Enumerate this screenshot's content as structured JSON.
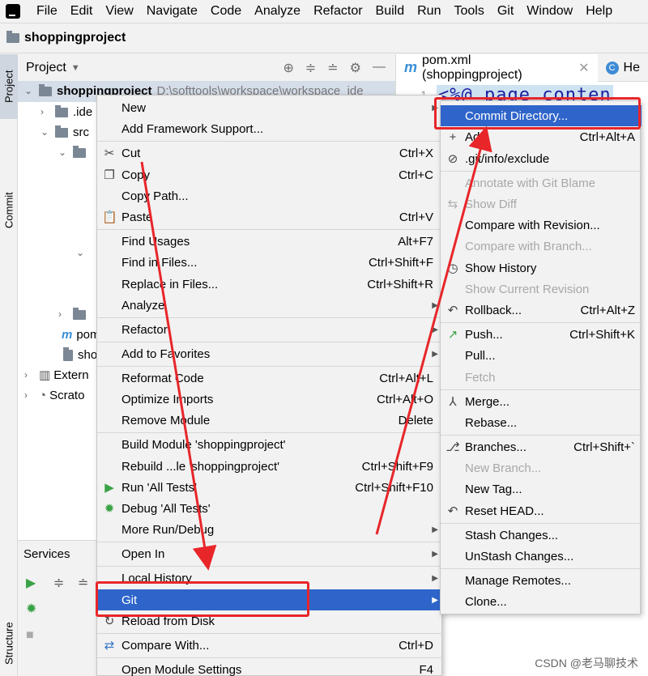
{
  "menubar": {
    "items": [
      "File",
      "Edit",
      "View",
      "Navigate",
      "Code",
      "Analyze",
      "Refactor",
      "Build",
      "Run",
      "Tools",
      "Git",
      "Window",
      "Help"
    ]
  },
  "breadcrumb": {
    "project": "shoppingproject"
  },
  "stripe": {
    "project_tab": "Project",
    "commit_tab": "Commit",
    "structure_tab": "Structure"
  },
  "project_panel": {
    "title": "Project",
    "root_name": "shoppingproject",
    "root_path": "D:\\softtools\\workspace\\workspace_ide",
    "rows": {
      "idea": ".ide",
      "src": "src",
      "pom": "pom",
      "sho": "sho",
      "external": "Extern",
      "scratches": "Scrato"
    }
  },
  "services": {
    "title": "Services"
  },
  "editor": {
    "tab1": "pom.xml (shoppingproject)",
    "tab2": "He",
    "line_no": "1",
    "code": "<%@ page conten"
  },
  "context_menu": {
    "new": "New",
    "add_framework": "Add Framework Support...",
    "cut": "Cut",
    "cut_sc": "Ctrl+X",
    "copy": "Copy",
    "copy_sc": "Ctrl+C",
    "copy_path": "Copy Path...",
    "paste": "Paste",
    "paste_sc": "Ctrl+V",
    "find_usages": "Find Usages",
    "find_usages_sc": "Alt+F7",
    "find_in_files": "Find in Files...",
    "find_in_files_sc": "Ctrl+Shift+F",
    "replace_in_files": "Replace in Files...",
    "replace_in_files_sc": "Ctrl+Shift+R",
    "analyze": "Analyze",
    "refactor": "Refactor",
    "add_favorites": "Add to Favorites",
    "reformat": "Reformat Code",
    "reformat_sc": "Ctrl+Alt+L",
    "optimize": "Optimize Imports",
    "optimize_sc": "Ctrl+Alt+O",
    "remove_module": "Remove Module",
    "remove_module_sc": "Delete",
    "build_module": "Build Module 'shoppingproject'",
    "rebuild": "Rebuild ...le 'shoppingproject'",
    "rebuild_sc": "Ctrl+Shift+F9",
    "run_tests": "Run 'All Tests'",
    "run_tests_sc": "Ctrl+Shift+F10",
    "debug_tests": "Debug 'All Tests'",
    "more_run": "More Run/Debug",
    "open_in": "Open In",
    "local_history": "Local History",
    "git": "Git",
    "reload": "Reload from Disk",
    "compare_with": "Compare With...",
    "compare_with_sc": "Ctrl+D",
    "open_module_settings": "Open Module Settings",
    "open_module_settings_sc": "F4"
  },
  "git_submenu": {
    "commit_dir": "Commit Directory...",
    "add": "Add",
    "add_sc": "Ctrl+Alt+A",
    "exclude": ".git/info/exclude",
    "annotate": "Annotate with Git Blame",
    "show_diff": "Show Diff",
    "compare_revision": "Compare with Revision...",
    "compare_branch": "Compare with Branch...",
    "show_history": "Show History",
    "show_current_revision": "Show Current Revision",
    "rollback": "Rollback...",
    "rollback_sc": "Ctrl+Alt+Z",
    "push": "Push...",
    "push_sc": "Ctrl+Shift+K",
    "pull": "Pull...",
    "fetch": "Fetch",
    "merge": "Merge...",
    "rebase": "Rebase...",
    "branches": "Branches...",
    "branches_sc": "Ctrl+Shift+`",
    "new_branch": "New Branch...",
    "new_tag": "New Tag...",
    "reset_head": "Reset HEAD...",
    "stash": "Stash Changes...",
    "unstash": "UnStash Changes...",
    "manage_remotes": "Manage Remotes...",
    "clone": "Clone..."
  },
  "watermark": "CSDN @老马聊技术",
  "colors": {
    "highlight": "#2f65ca",
    "annotation_red": "#e8262a",
    "selected_row": "#d5dde8"
  }
}
